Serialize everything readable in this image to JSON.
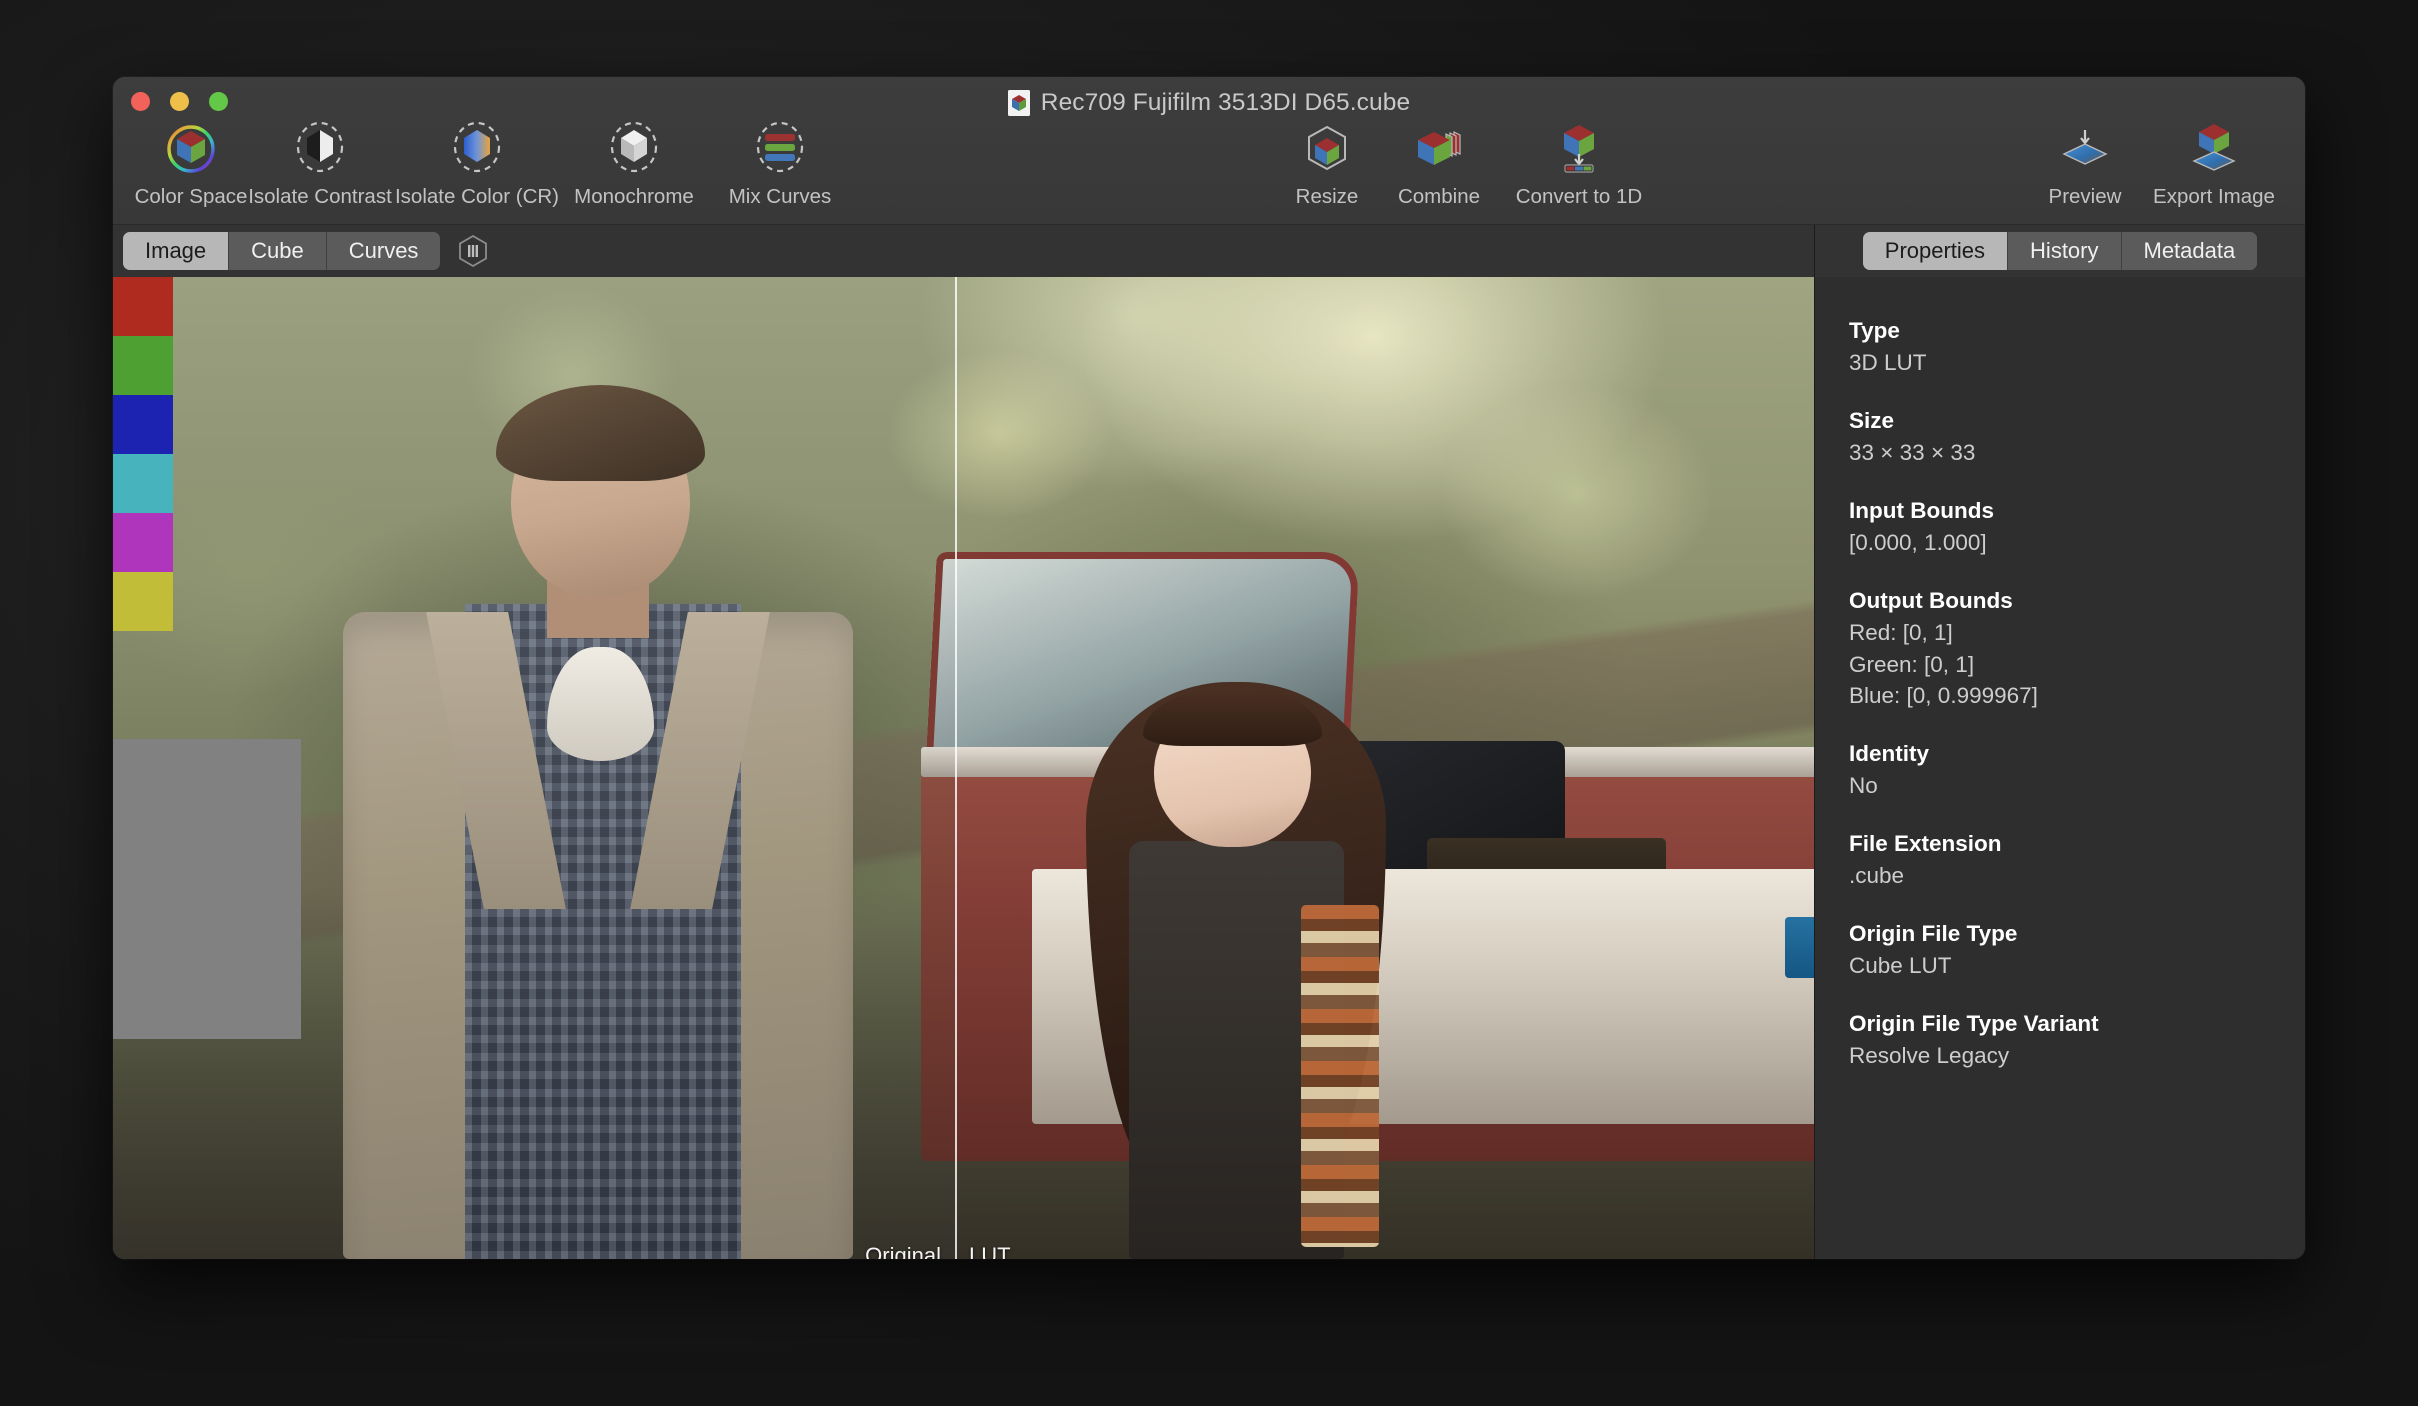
{
  "window": {
    "title": "Rec709 Fujifilm 3513DI D65.cube",
    "controls": {
      "close": "close-button",
      "minimize": "minimize-button",
      "zoom": "zoom-button"
    }
  },
  "toolbar": {
    "left_group": [
      {
        "label": "Color Space",
        "icon": "color-space-icon"
      },
      {
        "label": "Isolate Contrast",
        "icon": "isolate-contrast-icon"
      },
      {
        "label": "Isolate Color (CR)",
        "icon": "isolate-color-icon"
      },
      {
        "label": "Monochrome",
        "icon": "monochrome-icon"
      },
      {
        "label": "Mix Curves",
        "icon": "mix-curves-icon"
      }
    ],
    "center_group": [
      {
        "label": "Resize",
        "icon": "resize-icon"
      },
      {
        "label": "Combine",
        "icon": "combine-icon"
      },
      {
        "label": "Convert to 1D",
        "icon": "convert-to-1d-icon"
      }
    ],
    "right_group": [
      {
        "label": "Preview",
        "icon": "preview-icon"
      },
      {
        "label": "Export Image",
        "icon": "export-image-icon"
      }
    ]
  },
  "viewer": {
    "tabs": [
      {
        "label": "Image",
        "selected": true
      },
      {
        "label": "Cube",
        "selected": false
      },
      {
        "label": "Curves",
        "selected": false
      }
    ],
    "hex_button": "hexagon-bars-icon",
    "compare_labels": {
      "original": "Original",
      "lut": "LUT"
    },
    "swatches": [
      "#b02b1f",
      "#4fa032",
      "#1b23b0",
      "#46b3bd",
      "#b035bd",
      "#c1bd38"
    ],
    "gray_patch_color": "#818181"
  },
  "inspector": {
    "tabs": [
      {
        "label": "Properties",
        "selected": true
      },
      {
        "label": "History",
        "selected": false
      },
      {
        "label": "Metadata",
        "selected": false
      }
    ],
    "properties": [
      {
        "key": "Type",
        "values": [
          "3D LUT"
        ]
      },
      {
        "key": "Size",
        "values": [
          "33 × 33 × 33"
        ]
      },
      {
        "key": "Input Bounds",
        "values": [
          "[0.000, 1.000]"
        ]
      },
      {
        "key": "Output Bounds",
        "values": [
          "Red: [0, 1]",
          "Green: [0, 1]",
          "Blue: [0, 0.999967]"
        ]
      },
      {
        "key": "Identity",
        "values": [
          "No"
        ]
      },
      {
        "key": "File Extension",
        "values": [
          ".cube"
        ]
      },
      {
        "key": "Origin File Type",
        "values": [
          "Cube LUT"
        ]
      },
      {
        "key": "Origin File Type Variant",
        "values": [
          "Resolve Legacy"
        ]
      }
    ]
  },
  "colors": {
    "window_chrome": "#3a3a3a",
    "panel_bg": "#2e2e2e",
    "tab_active_bg": "#b7b7b7",
    "tab_inactive_bg": "#5b5b5b",
    "traffic_close": "#f3625a",
    "traffic_min": "#eec04a",
    "traffic_zoom": "#63c747"
  }
}
